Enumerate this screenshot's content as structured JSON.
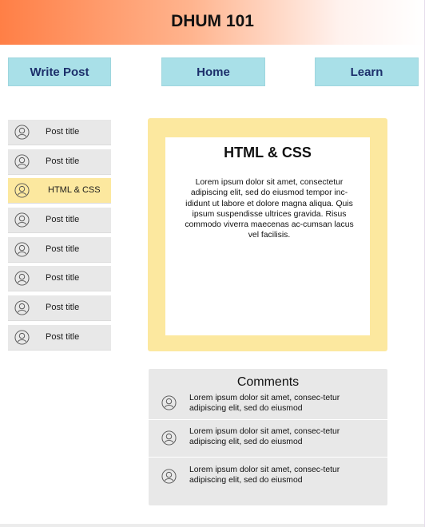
{
  "header": {
    "title": "DHUM 101"
  },
  "nav": {
    "write_post": "Write Post",
    "home": "Home",
    "learn": "Learn"
  },
  "sidebar": {
    "items": [
      {
        "label": "Post title"
      },
      {
        "label": "Post title"
      },
      {
        "label": "HTML & CSS",
        "active": true
      },
      {
        "label": "Post title"
      },
      {
        "label": "Post title"
      },
      {
        "label": "Post title"
      },
      {
        "label": "Post title"
      },
      {
        "label": "Post title"
      }
    ]
  },
  "article": {
    "title": "HTML & CSS",
    "body": "Lorem ipsum dolor sit amet, consectetur adipiscing elit, sed do eiusmod tempor inc-ididunt ut labore et dolore magna aliqua. Quis ipsum suspendisse ultrices gravida. Risus commodo viverra maecenas ac-cumsan lacus vel facilisis."
  },
  "comments": {
    "title": "Comments",
    "items": [
      {
        "text": "Lorem ipsum dolor sit amet, consec-tetur adipiscing elit, sed do eiusmod"
      },
      {
        "text": "Lorem ipsum dolor sit amet, consec-tetur adipiscing elit, sed do eiusmod"
      },
      {
        "text": "Lorem ipsum dolor sit amet, consec-tetur adipiscing elit, sed do eiusmod"
      }
    ]
  },
  "colors": {
    "header_gradient_start": "#ff7f46",
    "nav_button": "#a9e0e8",
    "nav_text": "#1c2f6b",
    "active_post": "#fce89f",
    "panel_gray": "#e8e8e8"
  },
  "icons": {
    "avatar": "user-avatar-icon"
  }
}
